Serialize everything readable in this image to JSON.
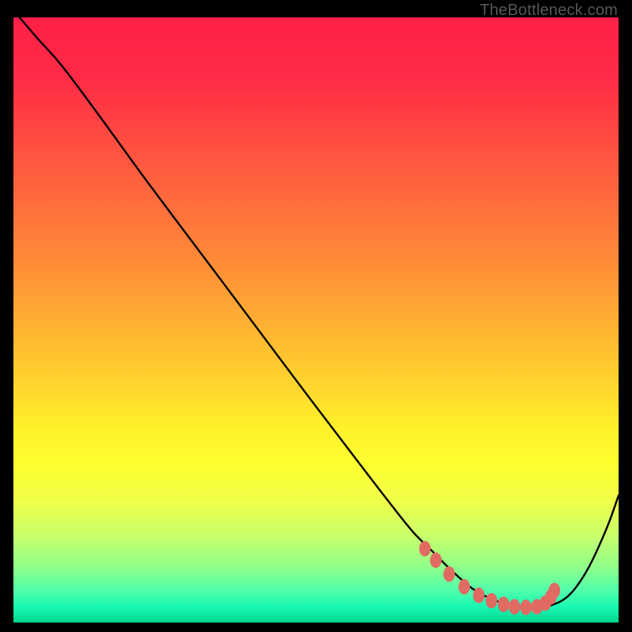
{
  "watermark": "TheBottleneck.com",
  "chart_data": {
    "type": "line",
    "title": "",
    "xlabel": "",
    "ylabel": "",
    "xlim": [
      0,
      100
    ],
    "ylim": [
      0,
      100
    ],
    "background_gradient": {
      "stops": [
        {
          "offset": 0.0,
          "color": "#ff1f47"
        },
        {
          "offset": 0.1,
          "color": "#ff2b46"
        },
        {
          "offset": 0.25,
          "color": "#ff5b3f"
        },
        {
          "offset": 0.4,
          "color": "#ff8a38"
        },
        {
          "offset": 0.55,
          "color": "#ffc030"
        },
        {
          "offset": 0.68,
          "color": "#fff12a"
        },
        {
          "offset": 0.74,
          "color": "#feff2f"
        },
        {
          "offset": 0.8,
          "color": "#f0ff4a"
        },
        {
          "offset": 0.86,
          "color": "#c6ff6d"
        },
        {
          "offset": 0.91,
          "color": "#8dff8c"
        },
        {
          "offset": 0.95,
          "color": "#4bffac"
        },
        {
          "offset": 0.975,
          "color": "#17f7b3"
        },
        {
          "offset": 1.0,
          "color": "#02d58e"
        }
      ]
    },
    "series": [
      {
        "name": "bottleneck-curve",
        "type": "line",
        "x": [
          1,
          4,
          8,
          14,
          22,
          31,
          40,
          49,
          57,
          62,
          66,
          69,
          72,
          76,
          80,
          83,
          86,
          89,
          92,
          95,
          98,
          100
        ],
        "y": [
          100,
          96.5,
          92,
          84,
          73,
          61,
          49,
          37,
          26.5,
          20,
          15,
          12,
          9,
          5.5,
          3.5,
          2.7,
          2.5,
          2.9,
          4.7,
          9,
          15.5,
          21
        ]
      },
      {
        "name": "optimal-zone-dots",
        "type": "scatter",
        "x": [
          68.0,
          69.8,
          72.0,
          74.5,
          76.9,
          79.0,
          81.0,
          82.8,
          84.7,
          86.5,
          87.9,
          88.8,
          89.4
        ],
        "y": [
          12.2,
          10.3,
          8.0,
          5.9,
          4.5,
          3.6,
          3.0,
          2.6,
          2.5,
          2.6,
          3.2,
          4.2,
          5.3
        ]
      }
    ]
  }
}
